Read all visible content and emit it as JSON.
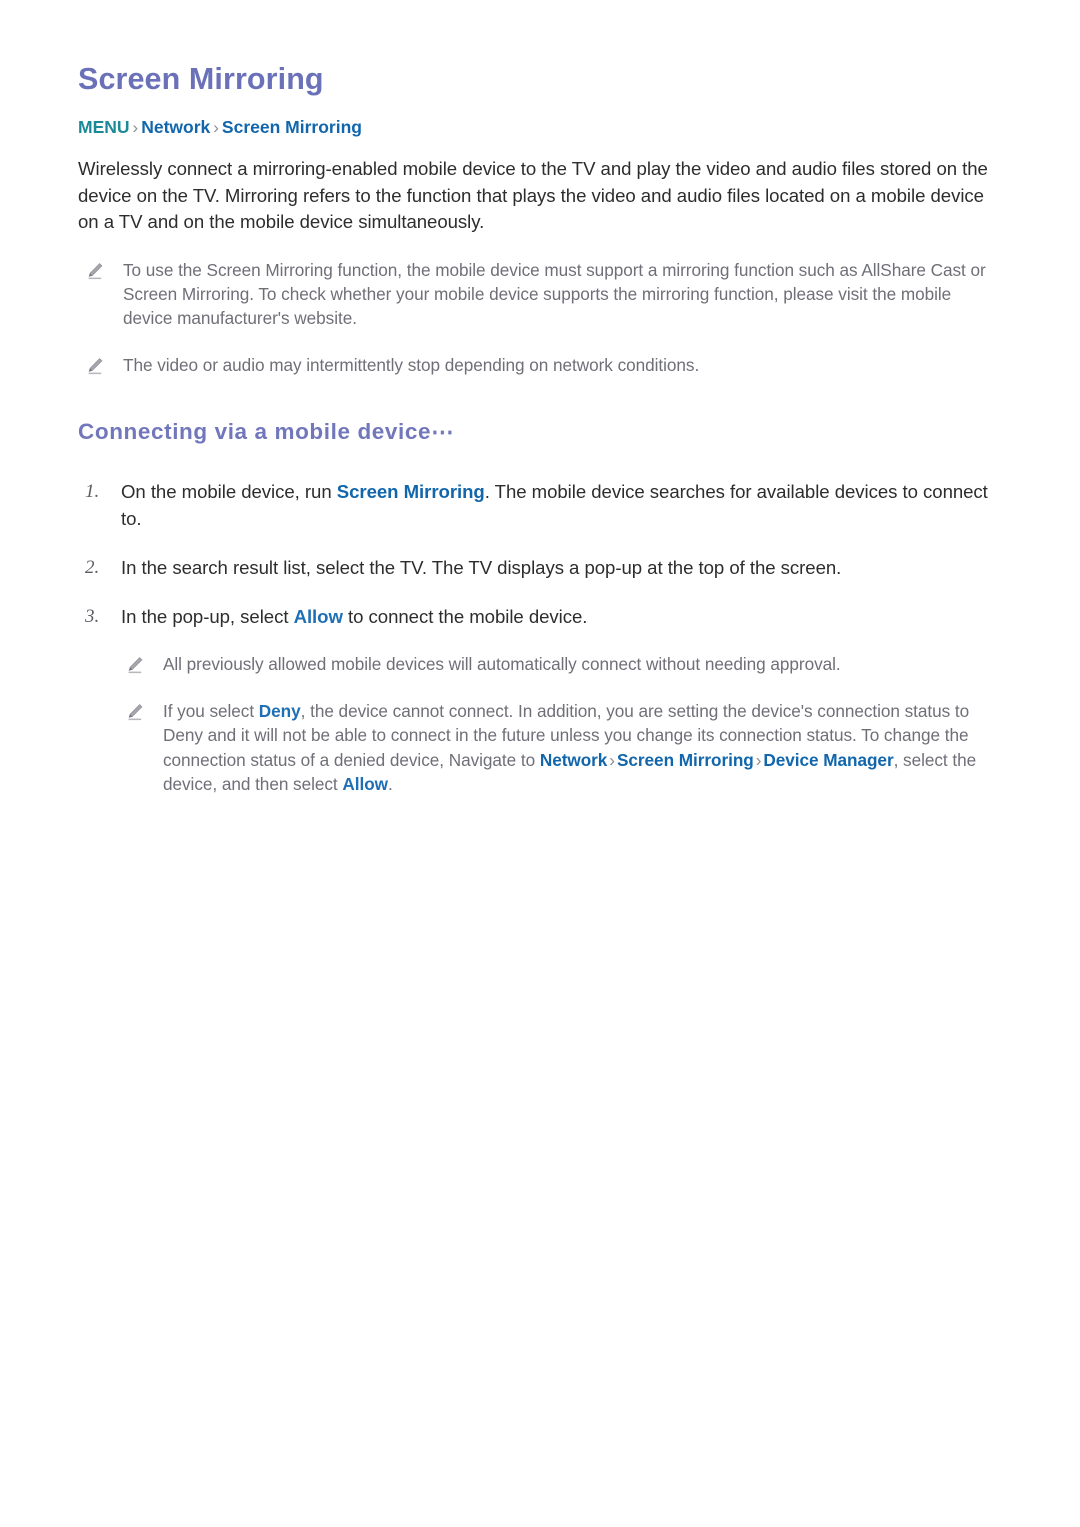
{
  "document": {
    "title": "Screen Mirroring"
  },
  "breadcrumb": {
    "menu": "MENU",
    "separator": "›",
    "items": [
      "Network",
      "Screen Mirroring"
    ]
  },
  "intro": {
    "paragraph": "Wirelessly connect a mirroring-enabled mobile device to the TV and play the video and audio files stored on the device on the TV. Mirroring refers to the function that plays the video and audio files located on a mobile device on a TV and on the mobile device simultaneously."
  },
  "top_notes": [
    {
      "icon": "pencil-note-icon",
      "text": "To use the Screen Mirroring function, the mobile device must support a mirroring function such as AllShare Cast or Screen Mirroring. To check whether your mobile device supports the mirroring function, please visit the mobile device manufacturer's website."
    },
    {
      "icon": "pencil-note-icon",
      "text": "The video or audio may intermittently stop depending on network conditions."
    }
  ],
  "section": {
    "heading": "Connecting via a mobile device⋯"
  },
  "steps": [
    {
      "number": "1.",
      "text_before": "On the mobile device, run ",
      "link": "Screen Mirroring",
      "text_after": ". The mobile device searches for available devices to connect to."
    },
    {
      "number": "2.",
      "text_before": "In the search result list, select the TV. The TV displays a pop-up at the top of the screen.",
      "link": "",
      "text_after": ""
    },
    {
      "number": "3.",
      "text_before": "In the pop-up, select ",
      "link": "Allow",
      "text_after": " to connect the mobile device."
    }
  ],
  "step_notes": [
    {
      "icon": "pencil-note-icon",
      "text": "All previously allowed mobile devices will automatically connect without needing approval."
    },
    {
      "icon": "pencil-note-icon",
      "segment_1": "If you select ",
      "link_deny": "Deny",
      "segment_2": ", the device cannot connect. In addition, you are setting the device's connection status to Deny and it will not be able to connect in the future unless you change its connection status. To change the connection status of a denied device, Navigate to ",
      "link_network": "Network",
      "sep_1": "›",
      "link_screen_mirroring": "Screen Mirroring",
      "sep_2": "›",
      "link_device_manager": "Device Manager",
      "segment_3": ", select the device, and then select ",
      "link_allow": "Allow",
      "segment_4": "."
    }
  ],
  "colors": {
    "title_purple": "#6b71b8",
    "heading_purple": "#7277bb",
    "link_blue": "#1166ac",
    "menu_teal": "#1a8a96",
    "note_gray": "#6f6f78",
    "body_black": "#2d2d2d",
    "separator_gray": "#8d8d95"
  }
}
